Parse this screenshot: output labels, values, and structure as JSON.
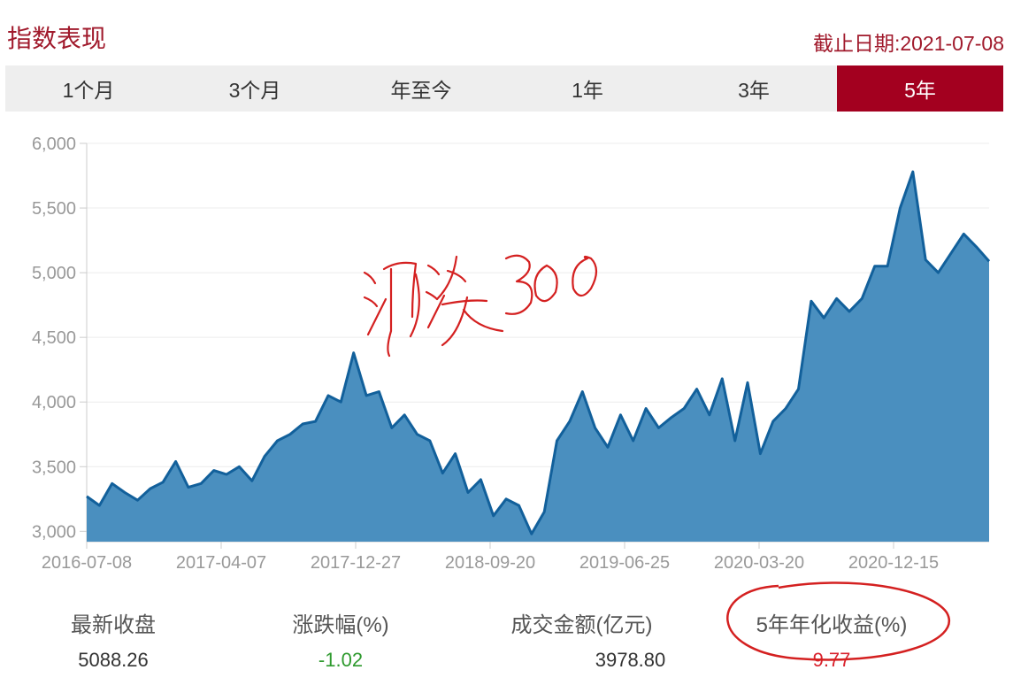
{
  "header": {
    "title": "指数表现",
    "as_of": "截止日期:2021-07-08"
  },
  "tabs": [
    {
      "label": "1个月",
      "active": false
    },
    {
      "label": "3个月",
      "active": false
    },
    {
      "label": "年至今",
      "active": false
    },
    {
      "label": "1年",
      "active": false
    },
    {
      "label": "3年",
      "active": false
    },
    {
      "label": "5年",
      "active": true
    }
  ],
  "colors": {
    "accent": "#a3001f",
    "area_fill": "#4a8fbf",
    "line": "#12609b",
    "positive": "#d9232e",
    "negative": "#2e9a2e"
  },
  "annotation": {
    "handwritten_text": "沪深300"
  },
  "chart_data": {
    "type": "area",
    "x_ticks": [
      "2016-07-08",
      "2017-04-07",
      "2017-12-27",
      "2018-09-20",
      "2019-06-25",
      "2020-03-20",
      "2020-12-15"
    ],
    "y_ticks": [
      "3,000",
      "3,500",
      "4,000",
      "4,500",
      "5,000",
      "5,500",
      "6,000"
    ],
    "ylim": [
      2920,
      6000
    ],
    "grid": true,
    "series": [
      {
        "values": [
          3270,
          3200,
          3370,
          3300,
          3240,
          3330,
          3380,
          3540,
          3340,
          3370,
          3470,
          3440,
          3500,
          3390,
          3580,
          3700,
          3750,
          3830,
          3850,
          4050,
          4000,
          4380,
          4050,
          4080,
          3800,
          3900,
          3750,
          3700,
          3450,
          3600,
          3300,
          3400,
          3120,
          3250,
          3200,
          2980,
          3150,
          3700,
          3850,
          4080,
          3800,
          3650,
          3900,
          3700,
          3950,
          3800,
          3880,
          3950,
          4100,
          3900,
          4180,
          3700,
          4150,
          3600,
          3850,
          3950,
          4100,
          4780,
          4650,
          4800,
          4700,
          4800,
          5050,
          5050,
          5500,
          5780,
          5100,
          5000,
          5150,
          5300,
          5200,
          5088
        ]
      }
    ]
  },
  "stats": [
    {
      "label": "最新收盘",
      "value": "5088.26"
    },
    {
      "label": "涨跌幅(%)",
      "value": "-1.02"
    },
    {
      "label": "成交金额(亿元)",
      "value": "3978.80"
    },
    {
      "label": "5年年化收益(%)",
      "value": "9.77"
    }
  ]
}
